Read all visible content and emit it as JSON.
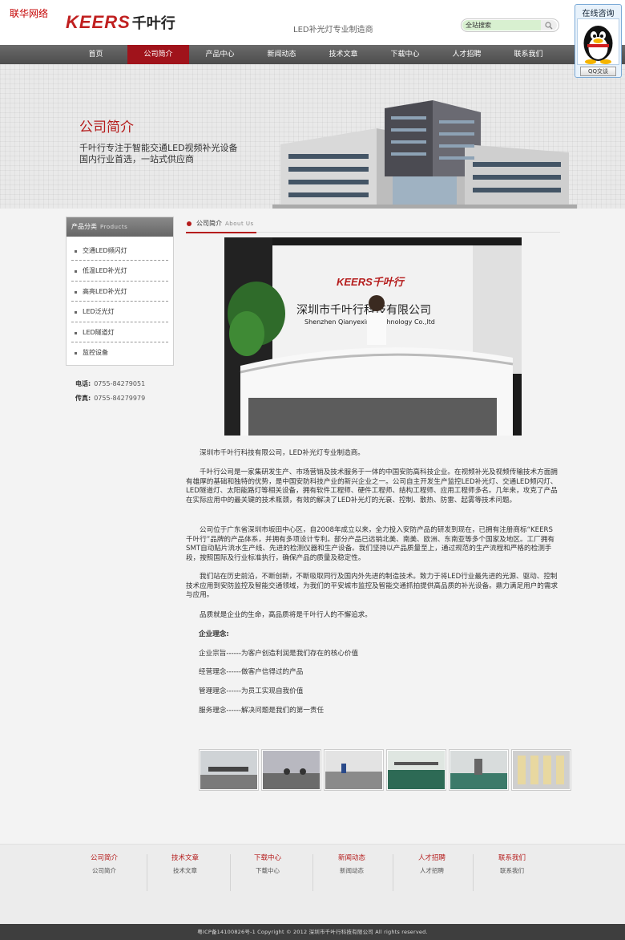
{
  "corner_tag": "联华网络",
  "logo": {
    "brand": "KEERS",
    "cn": "千叶行"
  },
  "tagline": "LED补光灯专业制造商",
  "search": {
    "value": "全站搜索"
  },
  "nav": [
    {
      "label": "首页"
    },
    {
      "label": "公司简介",
      "active": true
    },
    {
      "label": "产品中心"
    },
    {
      "label": "新闻动态"
    },
    {
      "label": "技术文章"
    },
    {
      "label": "下载中心"
    },
    {
      "label": "人才招聘"
    },
    {
      "label": "联系我们"
    }
  ],
  "banner": {
    "title": "公司简介",
    "line1": "千叶行专注于智能交通LED视频补光设备",
    "line2": "国内行业首选，一站式供应商"
  },
  "sidebar": {
    "title": "产品分类",
    "title_en": "Products",
    "items": [
      "交通LED频闪灯",
      "低温LED补光灯",
      "高亮LED补光灯",
      "LED泛光灯",
      "LED隧道灯",
      "监控设备"
    ]
  },
  "contact": {
    "phone_label": "电话:",
    "phone": "0755-84279051",
    "fax_label": "传真:",
    "fax": "0755-84279979"
  },
  "section": {
    "title": "公司简介",
    "title_en": "About Us"
  },
  "photo_sign": {
    "logo": "KEERS千叶行",
    "cn": "深圳市千叶行科技有限公司",
    "en": "Shenzhen Qianyexing Technology Co.,ltd"
  },
  "article": {
    "p1": "深圳市千叶行科技有限公司，LED补光灯专业制造商。",
    "p2": "千叶行公司是一家集研发生产、市场营销及技术服务于一体的中国安防高科技企业。在视频补光及视频传输技术方面拥有雄厚的基础和独特的优势，是中国安防科技产业的新兴企业之一。公司自主开发生产监控LED补光灯、交通LED频闪灯、LED隧道灯、太阳能路灯等相关设备，拥有软件工程师、硬件工程师、结构工程师、应用工程师多名。几年来，攻克了产品在实际应用中的最关键的技术瓶颈，有效的解决了LED补光灯的光衰、控制、散热、防雷、起雾等技术问题。",
    "p3": "公司位于广东省深圳市坂田中心区，自2008年成立以来，全力投入安防产品的研发到现在，已拥有注册商标“KEERS千叶行”品牌的产品体系，并拥有多项设计专利。部分产品已远销北美、南美、欧洲、东南亚等多个国家及地区。工厂拥有SMT自动贴片流水生产线、先进的检测仪器和生产设备。我们坚持以产品质量至上，通过规范的生产流程和严格的检测手段，按照国际及行业标准执行，确保产品的质量及稳定性。",
    "p4": "我们站在历史前沿，不断创新，不断吸取同行及国内外先进的制造技术。致力于将LED行业最先进的光源、驱动、控制技术应用到安防监控及智能交通领域，为我们的平安城市监控及智能交通抓拍提供高品质的补光设备。鼎力满足用户的需求与应用。",
    "p5": "品质就是企业的生命，高品质将是千叶行人的不懈追求。",
    "concept_title": "企业理念:",
    "concepts": [
      "企业宗旨------为客户创造利润是我们存在的核心价值",
      "经营理念------做客户信得过的产品",
      "管理理念------为员工实现自我价值",
      "服务理念------解决问题是我们的第一责任"
    ]
  },
  "footer": {
    "cols": [
      {
        "head": "公司简介",
        "link": "公司简介"
      },
      {
        "head": "技术文章",
        "link": "技术文章"
      },
      {
        "head": "下载中心",
        "link": "下载中心"
      },
      {
        "head": "新闻动态",
        "link": "新闻动态"
      },
      {
        "head": "人才招聘",
        "link": "人才招聘"
      },
      {
        "head": "联系我们",
        "link": "联系我们"
      }
    ],
    "copyright": "粤ICP备14100826号-1 Copyright © 2012 深圳市千叶行科技有限公司 All rights reserved."
  },
  "qq": {
    "title": "在线咨询",
    "button": "QQ交谈"
  },
  "colors": {
    "brand_red": "#b51c1c",
    "nav_active": "#a0131b",
    "nav_bg": "#5a5a5a"
  }
}
